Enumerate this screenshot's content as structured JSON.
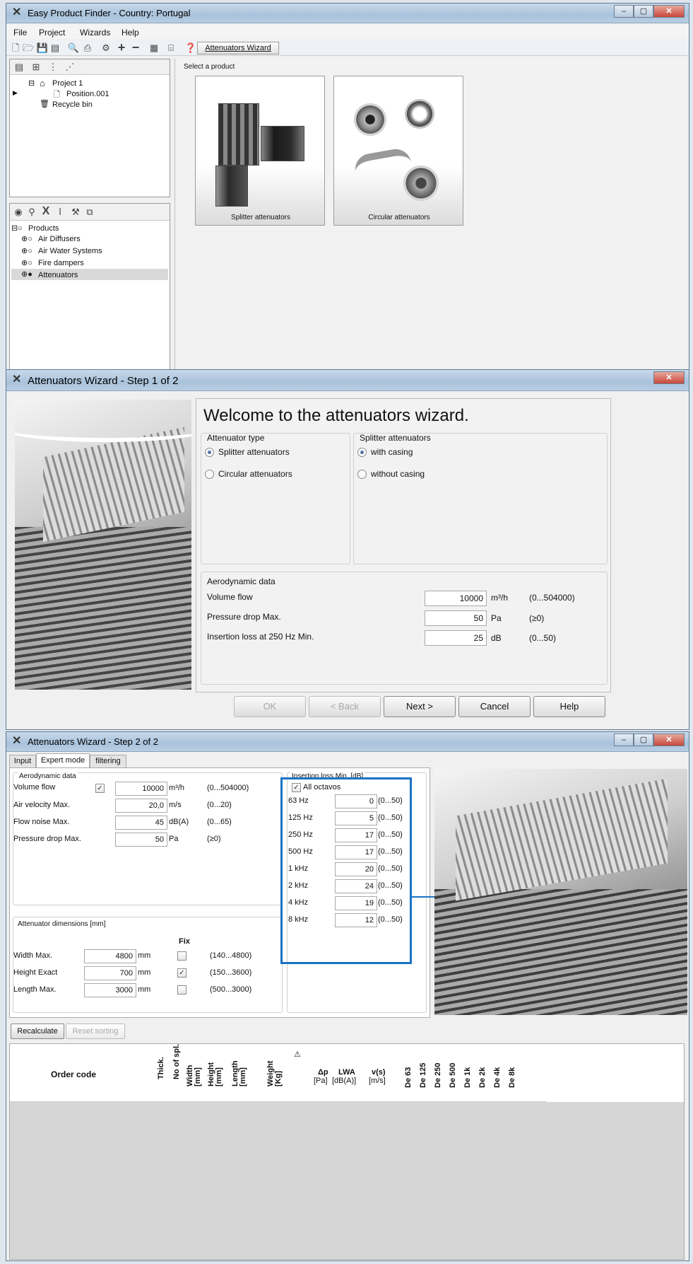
{
  "main_window": {
    "title": "Easy Product Finder - Country: Portugal",
    "menu": [
      "File",
      "Project",
      "Wizards",
      "Help"
    ],
    "toolbar_tab": "Attenuators Wizard",
    "project_tree": {
      "project": "Project 1",
      "position": "Position.001",
      "recycle": "Recycle bin"
    },
    "products_tree": {
      "root": "Products",
      "items": [
        "Air Diffusers",
        "Air Water Systems",
        "Fire dampers",
        "Attenuators"
      ]
    },
    "select_label": "Select a product",
    "cards": [
      {
        "label": "Splitter attenuators"
      },
      {
        "label": "Circular attenuators"
      }
    ]
  },
  "wizard1": {
    "title": "Attenuators Wizard - Step 1 of 2",
    "heading": "Welcome to the attenuators wizard.",
    "type_group": "Attenuator type",
    "type_options": [
      "Splitter attenuators",
      "Circular attenuators"
    ],
    "splitter_group": "Splitter attenuators",
    "splitter_options": [
      "with casing",
      "without casing"
    ],
    "aero_group": "Aerodynamic data",
    "rows": [
      {
        "label": "Volume flow",
        "value": "10000",
        "unit": "m³/h",
        "range": "(0...504000)"
      },
      {
        "label": "Pressure drop Max.",
        "value": "50",
        "unit": "Pa",
        "range": "(≥0)"
      },
      {
        "label": "Insertion loss at 250 Hz Min.",
        "value": "25",
        "unit": "dB",
        "range": "(0...50)"
      }
    ],
    "buttons": {
      "ok": "OK",
      "back": "< Back",
      "next": "Next >",
      "cancel": "Cancel",
      "help": "Help"
    }
  },
  "wizard2": {
    "title": "Attenuators Wizard - Step 2 of 2",
    "tabs": [
      "Input",
      "Expert mode",
      "filtering"
    ],
    "aero_group": "Aerodynamic data",
    "aero_rows": [
      {
        "label": "Volume flow",
        "value": "10000",
        "unit": "m³/h",
        "range": "(0...504000)"
      },
      {
        "label": "Air velocity Max.",
        "value": "20,0",
        "unit": "m/s",
        "range": "(0...20)"
      },
      {
        "label": "Flow noise Max.",
        "value": "45",
        "unit": "dB(A)",
        "range": "(0...65)"
      },
      {
        "label": "Pressure drop Max.",
        "value": "50",
        "unit": "Pa",
        "range": "(≥0)"
      }
    ],
    "dim_group": "Attenuator dimensions [mm]",
    "fix_label": "Fix",
    "dim_rows": [
      {
        "label": "Width Max.",
        "value": "4800",
        "unit": "mm",
        "fixed": false,
        "range": "(140...4800)"
      },
      {
        "label": "Height Exact",
        "value": "700",
        "unit": "mm",
        "fixed": true,
        "range": "(150...3600)"
      },
      {
        "label": "Length Max.",
        "value": "3000",
        "unit": "mm",
        "fixed": false,
        "range": "(500...3000)"
      }
    ],
    "ins_group": "Insertion loss Min. [dB]",
    "all_octaves": "All octavos",
    "ins_rows": [
      {
        "label": "63 Hz",
        "value": "0",
        "range": "(0...50)"
      },
      {
        "label": "125 Hz",
        "value": "5",
        "range": "(0...50)"
      },
      {
        "label": "250 Hz",
        "value": "17",
        "range": "(0...50)"
      },
      {
        "label": "500 Hz",
        "value": "17",
        "range": "(0...50)"
      },
      {
        "label": "1 kHz",
        "value": "20",
        "range": "(0...50)"
      },
      {
        "label": "2 kHz",
        "value": "24",
        "range": "(0...50)"
      },
      {
        "label": "4 kHz",
        "value": "19",
        "range": "(0...50)"
      },
      {
        "label": "8 kHz",
        "value": "12",
        "range": "(0...50)"
      }
    ],
    "recalculate": "Recalculate",
    "reset_sorting": "Reset sorting",
    "table": {
      "order_code": "Order code",
      "vertical_headers": [
        "Thick.",
        "No of spl.",
        "Width [mm]",
        "Height [mm]",
        "Length [mm]",
        "Weight [Kg]"
      ],
      "headers": [
        {
          "top": "Δp",
          "bottom": "[Pa]"
        },
        {
          "top": "LWA",
          "bottom": "[dB(A)]"
        },
        {
          "top": "v(s)",
          "bottom": "[m/s]"
        }
      ],
      "de_headers": [
        "De 63",
        "De 125",
        "De 250",
        "De 500",
        "De 1k",
        "De 2k",
        "De 4k",
        "De 8k"
      ]
    }
  }
}
